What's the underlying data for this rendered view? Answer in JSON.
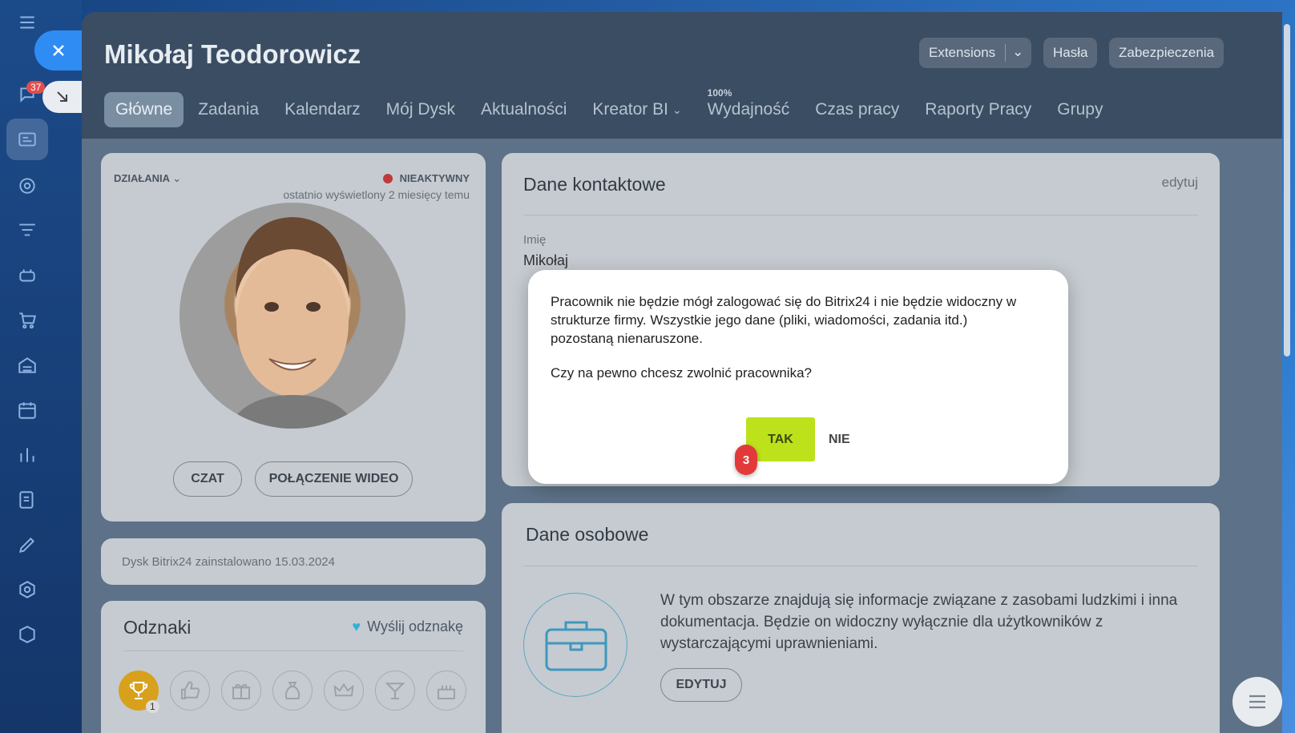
{
  "sidebar": {
    "badge": "37",
    "icons": [
      "menu-icon",
      "chat-icon",
      "contacts-icon",
      "target-icon",
      "funnel-icon",
      "robot-icon",
      "cart-icon",
      "warehouse-icon",
      "calendar-icon",
      "analytics-icon",
      "tasks-icon",
      "sign-icon",
      "settings-icon",
      "box-icon"
    ]
  },
  "header": {
    "title": "Mikołaj Teodorowicz",
    "extensions": "Extensions",
    "passwords": "Hasła",
    "security": "Zabezpieczenia"
  },
  "tabs": [
    {
      "label": "Główne"
    },
    {
      "label": "Zadania"
    },
    {
      "label": "Kalendarz"
    },
    {
      "label": "Mój Dysk"
    },
    {
      "label": "Aktualności"
    },
    {
      "label": "Kreator BI"
    },
    {
      "label": "Wydajność",
      "sup": "100%"
    },
    {
      "label": "Czas pracy"
    },
    {
      "label": "Raporty Pracy"
    },
    {
      "label": "Grupy"
    }
  ],
  "profile": {
    "actions": "DZIAŁANIA",
    "status": "NIEAKTYWNY",
    "last_seen": "ostatnio wyświetlony 2 miesięcy temu",
    "chat": "CZAT",
    "video": "POŁĄCZENIE WIDEO"
  },
  "disk": {
    "text": "Dysk Bitrix24 zainstalowano 15.03.2024"
  },
  "badges": {
    "title": "Odznaki",
    "send": "Wyślij odznakę",
    "count": "1"
  },
  "contact": {
    "title": "Dane kontaktowe",
    "edit": "edytuj",
    "name_label": "Imię",
    "name_value": "Mikołaj"
  },
  "personal": {
    "title": "Dane osobowe",
    "text1": "W tym obszarze znajdują się informacje związane z zasobami ludzkimi i inna",
    "text2": "dokumentacja. Będzie on widoczny wyłącznie dla użytkowników z",
    "text3": "wystarczającymi uprawnieniami.",
    "edit": "EDYTUJ"
  },
  "modal": {
    "line1": "Pracownik nie będzie mógł zalogować się do Bitrix24 i nie będzie widoczny w",
    "line2": "strukturze firmy. Wszystkie jego dane (pliki, wiadomości, zadania itd.)",
    "line3": "pozostaną nienaruszone.",
    "question": "Czy na pewno chcesz zwolnić pracownika?",
    "yes": "TAK",
    "no": "NIE",
    "step": "3"
  },
  "colors": {
    "accent": "#bde11a",
    "danger": "#e23a3a",
    "brand": "#2f8cf3"
  }
}
